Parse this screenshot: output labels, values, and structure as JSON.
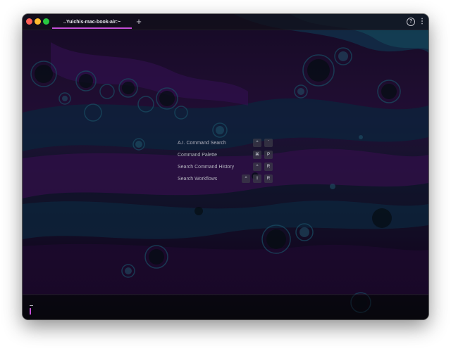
{
  "window": {
    "tab_title": "..Yuichis-mac-book-air:~",
    "new_tab_label": "+",
    "help_label": "?",
    "more_label": "⋮"
  },
  "shortcuts": [
    {
      "label": "A.I. Command Search",
      "keys": [
        "^",
        "`"
      ]
    },
    {
      "label": "Command Palette",
      "keys": [
        "⌘",
        "P"
      ]
    },
    {
      "label": "Search Command History",
      "keys": [
        "^",
        "R"
      ]
    },
    {
      "label": "Search Workflows",
      "keys": [
        "^",
        "⇧",
        "R"
      ]
    }
  ],
  "colors": {
    "accent": "#c44ed8",
    "close": "#ff5f57",
    "minimize": "#febc2e",
    "maximize": "#28c840"
  },
  "icons": [
    "close-icon",
    "minimize-icon",
    "maximize-icon",
    "plus-icon",
    "help-icon",
    "more-vertical-icon"
  ]
}
